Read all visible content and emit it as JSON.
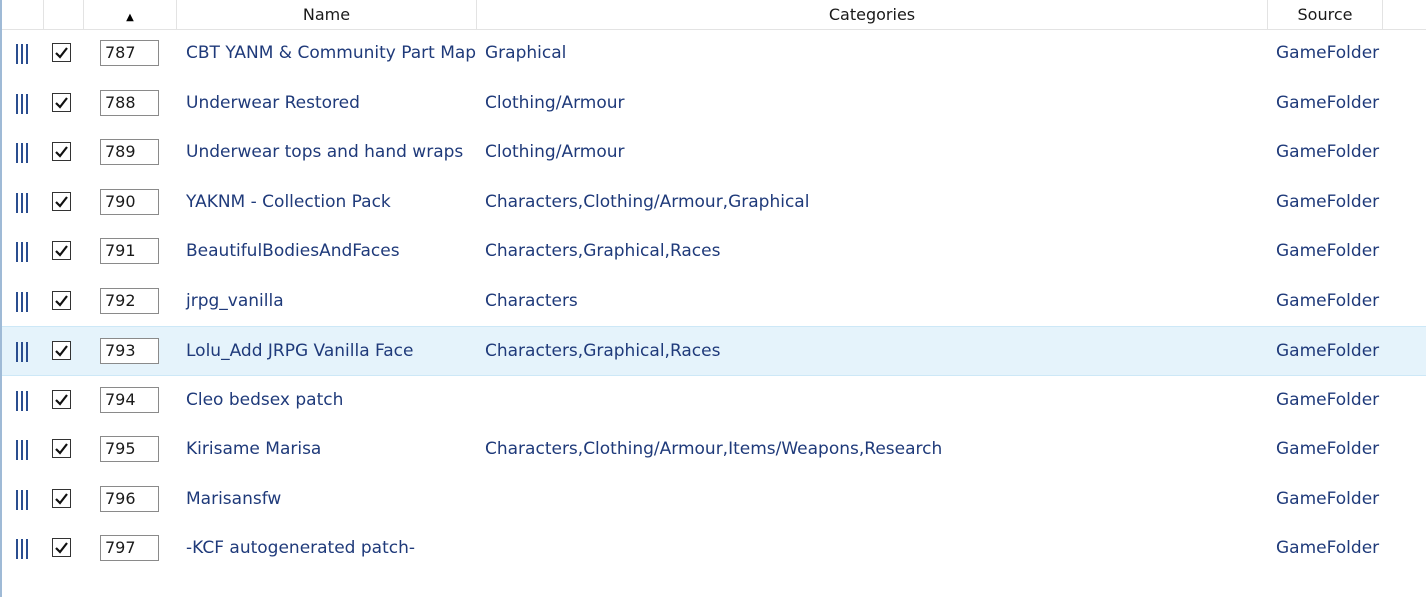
{
  "header": {
    "name_label": "Name",
    "categories_label": "Categories",
    "source_label": "Source",
    "sort_indicator": "▲"
  },
  "rows": [
    {
      "priority": "787",
      "name": "CBT YANM & Community Part Map",
      "categories": "Graphical",
      "source": "GameFolder",
      "checked": true
    },
    {
      "priority": "788",
      "name": "Underwear Restored",
      "categories": "Clothing/Armour",
      "source": "GameFolder",
      "checked": true
    },
    {
      "priority": "789",
      "name": "Underwear tops and hand wraps",
      "categories": "Clothing/Armour",
      "source": "GameFolder",
      "checked": true
    },
    {
      "priority": "790",
      "name": "YAKNM - Collection Pack",
      "categories": "Characters,Clothing/Armour,Graphical",
      "source": "GameFolder",
      "checked": true
    },
    {
      "priority": "791",
      "name": "BeautifulBodiesAndFaces",
      "categories": "Characters,Graphical,Races",
      "source": "GameFolder",
      "checked": true
    },
    {
      "priority": "792",
      "name": "jrpg_vanilla",
      "categories": "Characters",
      "source": "GameFolder",
      "checked": true
    },
    {
      "priority": "793",
      "name": "Lolu_Add JRPG Vanilla Face",
      "categories": "Characters,Graphical,Races",
      "source": "GameFolder",
      "checked": true,
      "selected": true
    },
    {
      "priority": "794",
      "name": "Cleo bedsex patch",
      "categories": "",
      "source": "GameFolder",
      "checked": true
    },
    {
      "priority": "795",
      "name": "Kirisame Marisa",
      "categories": "Characters,Clothing/Armour,Items/Weapons,Research",
      "source": "GameFolder",
      "checked": true
    },
    {
      "priority": "796",
      "name": "Marisansfw",
      "categories": "",
      "source": "GameFolder",
      "checked": true
    },
    {
      "priority": "797",
      "name": "-KCF autogenerated patch-",
      "categories": "",
      "source": "GameFolder",
      "checked": true
    }
  ],
  "colors": {
    "text": "#1f3a7a",
    "selection": "#e5f3fb",
    "grip": "#2a4d8f"
  },
  "icons": {
    "grip": "drag-handle-icon",
    "check": "check-icon",
    "sort": "sort-ascending-icon"
  }
}
